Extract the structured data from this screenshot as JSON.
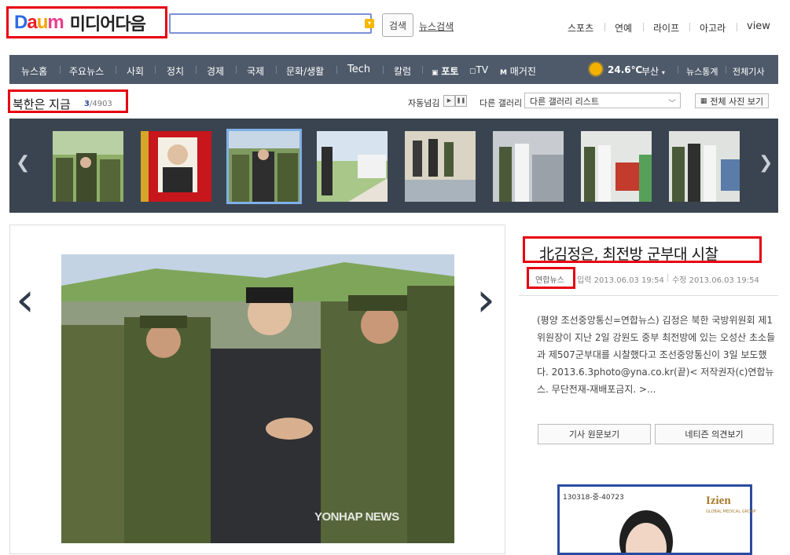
{
  "header": {
    "logo_mark": "Daum",
    "logo_text": "미디어다음",
    "search_placeholder": "",
    "search_button": "검색",
    "news_search": "뉴스검색",
    "top_links": [
      "스포츠",
      "연예",
      "라이프",
      "아고라",
      "view"
    ]
  },
  "nav": {
    "items": [
      "뉴스홈",
      "주요뉴스",
      "사회",
      "정치",
      "경제",
      "국제",
      "문화/생활",
      "Tech",
      "칼럼",
      "포토",
      "TV",
      "매거진"
    ],
    "weather_temp": "24.6℃",
    "weather_city": "부산",
    "stats": "뉴스통계",
    "all_articles": "전체기사"
  },
  "gallery": {
    "title": "북한은 지금",
    "current": "3",
    "total": "/4903",
    "autoplay_label": "자동넘김",
    "other_label": "다른 갤러리",
    "select_value": "다른 갤러리 리스트",
    "all_photos": "전체 사진 보기",
    "selected_index": 2
  },
  "article": {
    "headline": "北김정은, 최전방 군부대 시찰",
    "source": "연합뉴스",
    "input_time": "입력 2013.06.03 19:54",
    "modified_time": "수정 2013.06.03 19:54",
    "body": "(평양 조선중앙통신=연합뉴스) 김정은 북한 국방위원회 제1위원장이 지난 2일 강원도 중부 최전방에 있는 오성산 초소들과 제507군부대를 시찰했다고 조선중앙통신이 3일 보도했다. 2013.6.3photo@yna.co.kr(끝)< 저작권자(c)연합뉴스. 무단전재-재배포금지. >...",
    "original_button": "기사 원문보기",
    "opinion_button": "네티즌 의견보기",
    "watermark": "YONHAP NEWS"
  },
  "ad": {
    "code": "130318-중-40723",
    "brand": "Izien",
    "sub": "GLOBAL MEDICAL GROUP"
  }
}
